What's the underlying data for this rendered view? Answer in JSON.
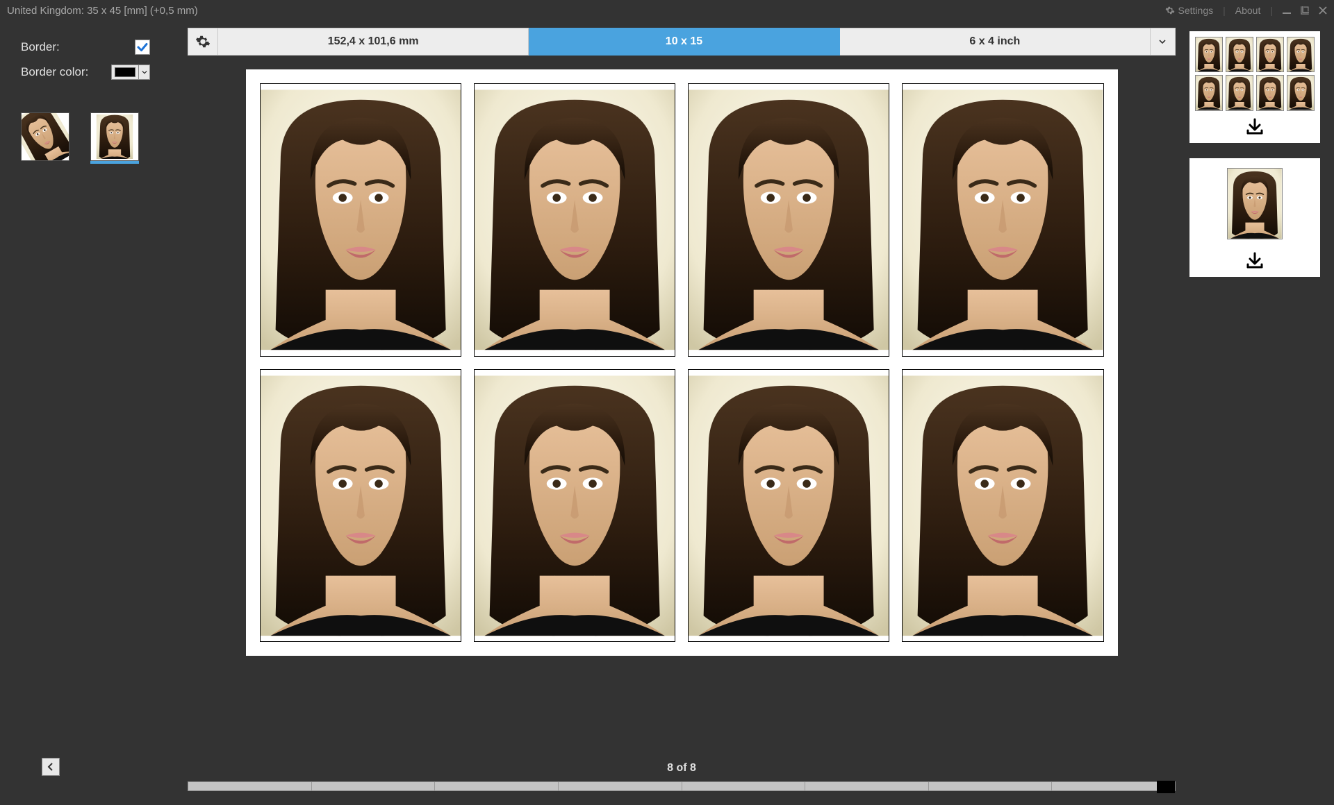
{
  "window": {
    "title": "United Kingdom: 35 x 45 [mm] (+0,5 mm)"
  },
  "menu": {
    "settings": "Settings",
    "about": "About"
  },
  "left": {
    "border_label": "Border:",
    "border_checked": true,
    "border_color_label": "Border color:",
    "border_color": "#000000",
    "thumbnails": [
      {
        "selected": false,
        "tilted": true
      },
      {
        "selected": true,
        "tilted": false
      }
    ]
  },
  "sizes": {
    "options": [
      "152,4 x 101,6 mm",
      "10 x 15",
      "6 x 4 inch"
    ],
    "active_index": 1
  },
  "sheet": {
    "rows": 2,
    "cols": 4
  },
  "counter": {
    "text": "8 of 8",
    "segments": 8,
    "value": 8
  },
  "right": {
    "cards": [
      {
        "type": "grid",
        "rows": 2,
        "cols": 4
      },
      {
        "type": "single"
      }
    ]
  }
}
